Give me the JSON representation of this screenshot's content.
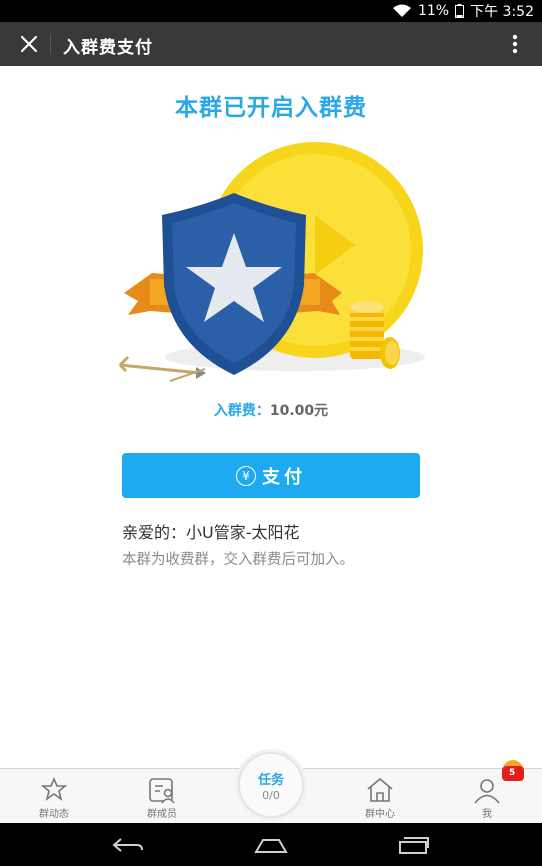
{
  "status_bar": {
    "battery": "11%",
    "time": "下午 3:52"
  },
  "header": {
    "title": "入群费支付"
  },
  "main": {
    "headline": "本群已开启入群费",
    "fee_label": "入群费：",
    "fee_amount": "10.00元",
    "pay_button_label": "支付",
    "greeting": "亲爱的：小U管家-太阳花",
    "note": "本群为收费群，交入群费后可加入。"
  },
  "tabbar": {
    "items": [
      {
        "label": "群动态",
        "icon": "star-bubble-icon"
      },
      {
        "label": "群成员",
        "icon": "members-card-icon"
      },
      {
        "label": "群中心",
        "icon": "house-icon"
      },
      {
        "label": "我",
        "icon": "person-icon"
      }
    ],
    "task": {
      "label": "任务",
      "count": "0/0"
    },
    "badge": "5"
  },
  "colors": {
    "accent": "#2aa7e8",
    "button": "#1eaaf1",
    "header": "#37393b"
  }
}
